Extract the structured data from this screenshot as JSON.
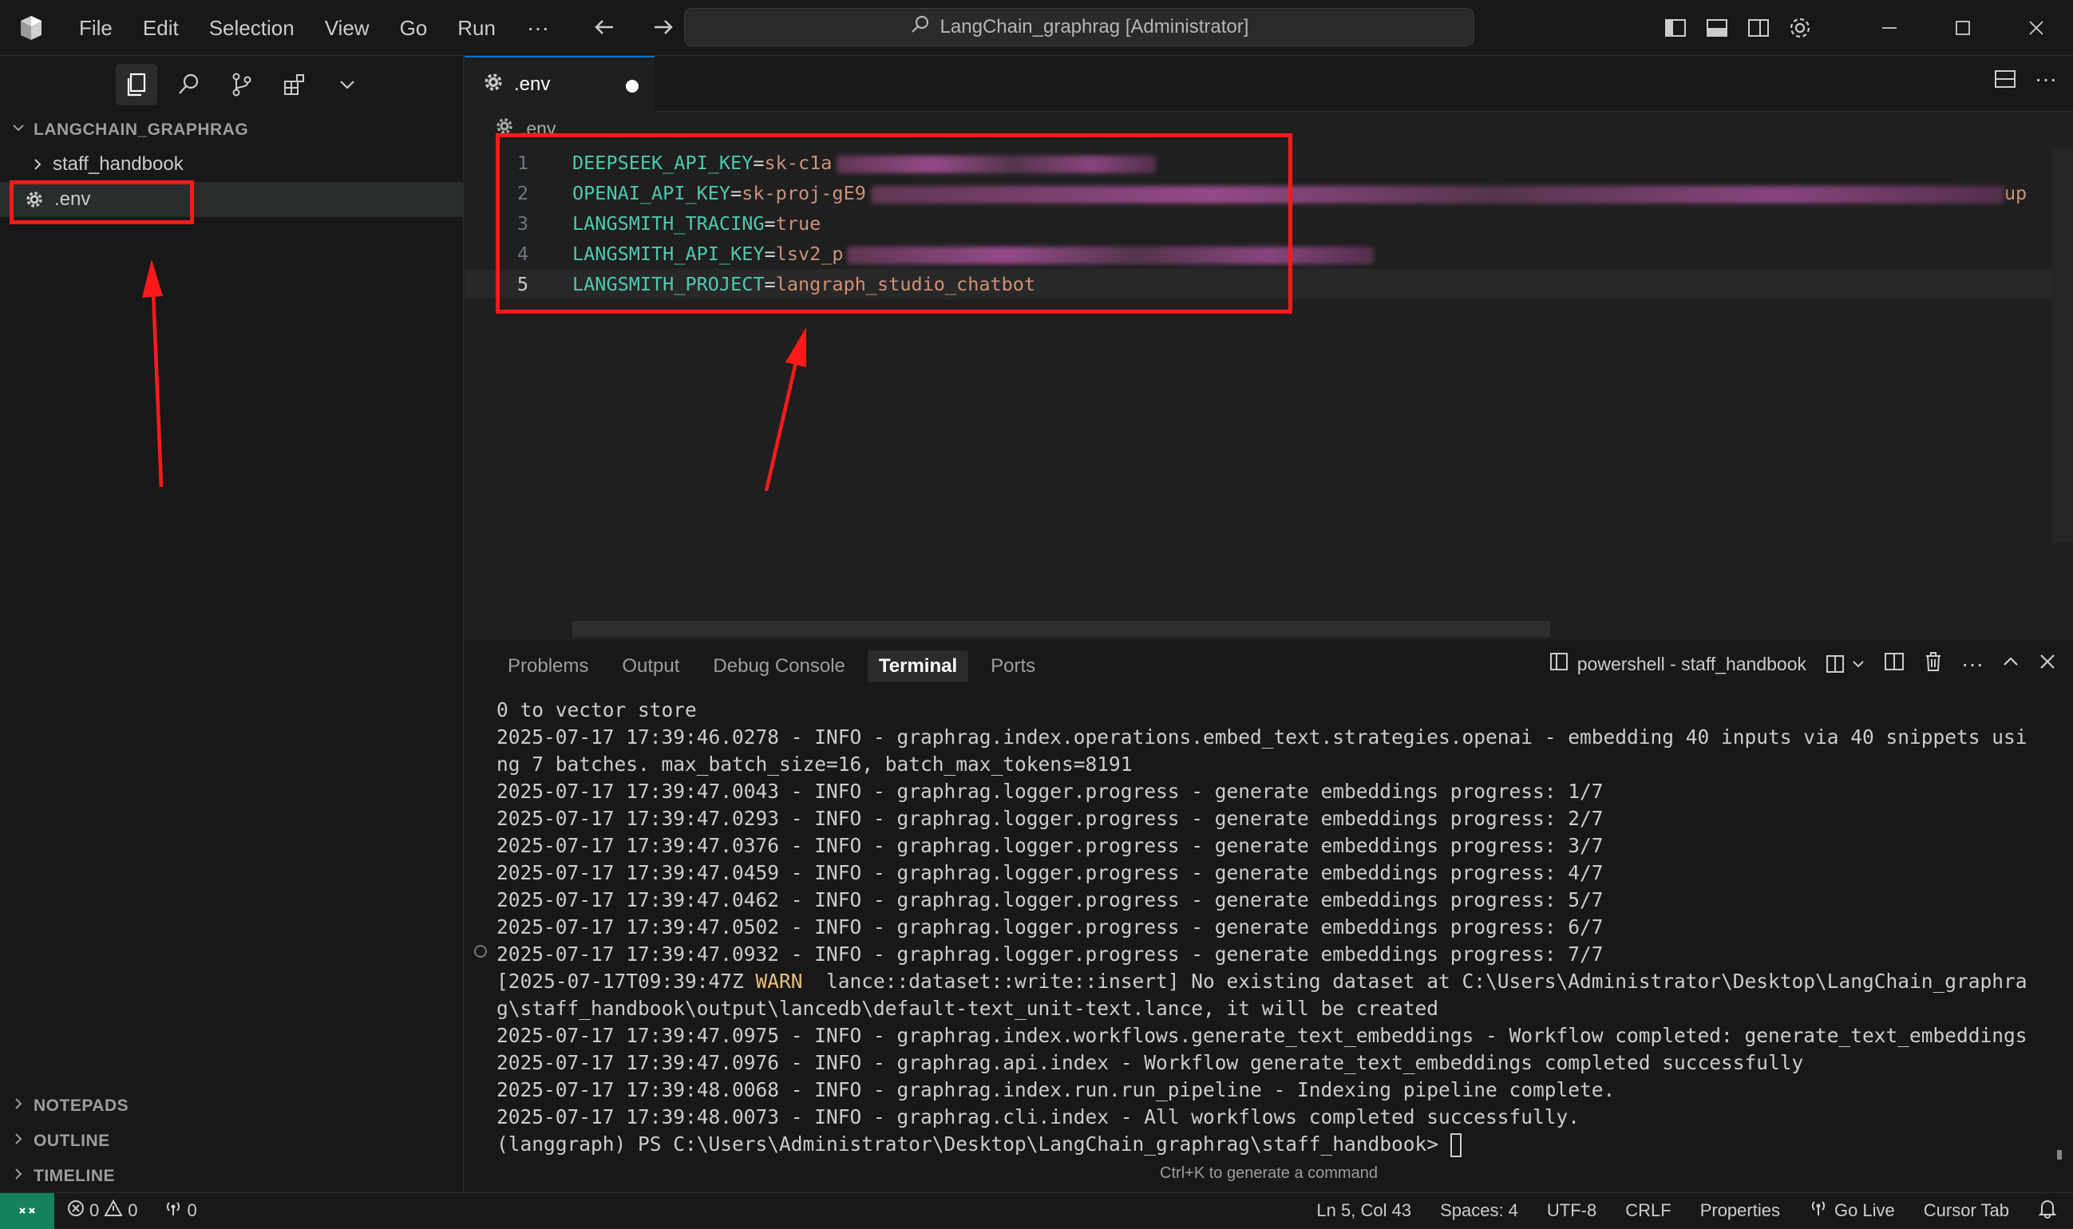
{
  "titlebar": {
    "menu": [
      "File",
      "Edit",
      "Selection",
      "View",
      "Go",
      "Run"
    ],
    "command_center": "LangChain_graphrag [Administrator]"
  },
  "sidebar": {
    "workspace": "LANGCHAIN_GRAPHRAG",
    "items": [
      {
        "label": "staff_handbook",
        "icon": "chevron-right-icon"
      },
      {
        "label": ".env",
        "icon": "gear-icon"
      }
    ],
    "sections": [
      "NOTEPADS",
      "OUTLINE",
      "TIMELINE"
    ]
  },
  "editor": {
    "tab_label": ".env",
    "breadcrumb": ".env",
    "lines": [
      {
        "num": "1",
        "key": "DEEPSEEK_API_KEY",
        "value": "sk-c1a"
      },
      {
        "num": "2",
        "key": "OPENAI_API_KEY",
        "value": "sk-proj-gE9"
      },
      {
        "num": "3",
        "key": "LANGSMITH_TRACING",
        "value": "true"
      },
      {
        "num": "4",
        "key": "LANGSMITH_API_KEY",
        "value": "lsv2_p"
      },
      {
        "num": "5",
        "key": "LANGSMITH_PROJECT",
        "value": "langraph_studio_chatbot"
      }
    ],
    "overflow_text": "up"
  },
  "panel": {
    "tabs": [
      "Problems",
      "Output",
      "Debug Console",
      "Terminal",
      "Ports"
    ],
    "active_tab": "Terminal",
    "terminal_name": "powershell - staff_handbook",
    "lines": [
      "0 to vector store",
      "2025-07-17 17:39:46.0278 - INFO - graphrag.index.operations.embed_text.strategies.openai - embedding 40 inputs via 40 snippets usi",
      "ng 7 batches. max_batch_size=16, batch_max_tokens=8191",
      "2025-07-17 17:39:47.0043 - INFO - graphrag.logger.progress - generate embeddings progress: 1/7",
      "2025-07-17 17:39:47.0293 - INFO - graphrag.logger.progress - generate embeddings progress: 2/7",
      "2025-07-17 17:39:47.0376 - INFO - graphrag.logger.progress - generate embeddings progress: 3/7",
      "2025-07-17 17:39:47.0459 - INFO - graphrag.logger.progress - generate embeddings progress: 4/7",
      "2025-07-17 17:39:47.0462 - INFO - graphrag.logger.progress - generate embeddings progress: 5/7",
      "2025-07-17 17:39:47.0502 - INFO - graphrag.logger.progress - generate embeddings progress: 6/7",
      "2025-07-17 17:39:47.0932 - INFO - graphrag.logger.progress - generate embeddings progress: 7/7"
    ],
    "warn_prefix": "[2025-07-17T09:39:47Z ",
    "warn_level": "WARN",
    "warn_rest": "  lance::dataset::write::insert] No existing dataset at C:\\Users\\Administrator\\Desktop\\LangChain_graphra",
    "lines_after": [
      "g\\staff_handbook\\output\\lancedb\\default-text_unit-text.lance, it will be created",
      "2025-07-17 17:39:47.0975 - INFO - graphrag.index.workflows.generate_text_embeddings - Workflow completed: generate_text_embeddings",
      "2025-07-17 17:39:47.0976 - INFO - graphrag.api.index - Workflow generate_text_embeddings completed successfully",
      "2025-07-17 17:39:48.0068 - INFO - graphrag.index.run.run_pipeline - Indexing pipeline complete.",
      "2025-07-17 17:39:48.0073 - INFO - graphrag.cli.index - All workflows completed successfully."
    ],
    "prompt": "(langgraph) PS C:\\Users\\Administrator\\Desktop\\LangChain_graphrag\\staff_handbook> ",
    "hint": "Ctrl+K to generate a command"
  },
  "statusbar": {
    "errors": "0",
    "warnings": "0",
    "ports": "0",
    "position": "Ln 5, Col 43",
    "spaces": "Spaces: 4",
    "encoding": "UTF-8",
    "eol": "CRLF",
    "language": "Properties",
    "golive": "Go Live",
    "cursor_tab": "Cursor Tab"
  },
  "colors": {
    "accent": "#0078d4",
    "annotation": "#ff1a1a",
    "remote": "#16825d"
  }
}
